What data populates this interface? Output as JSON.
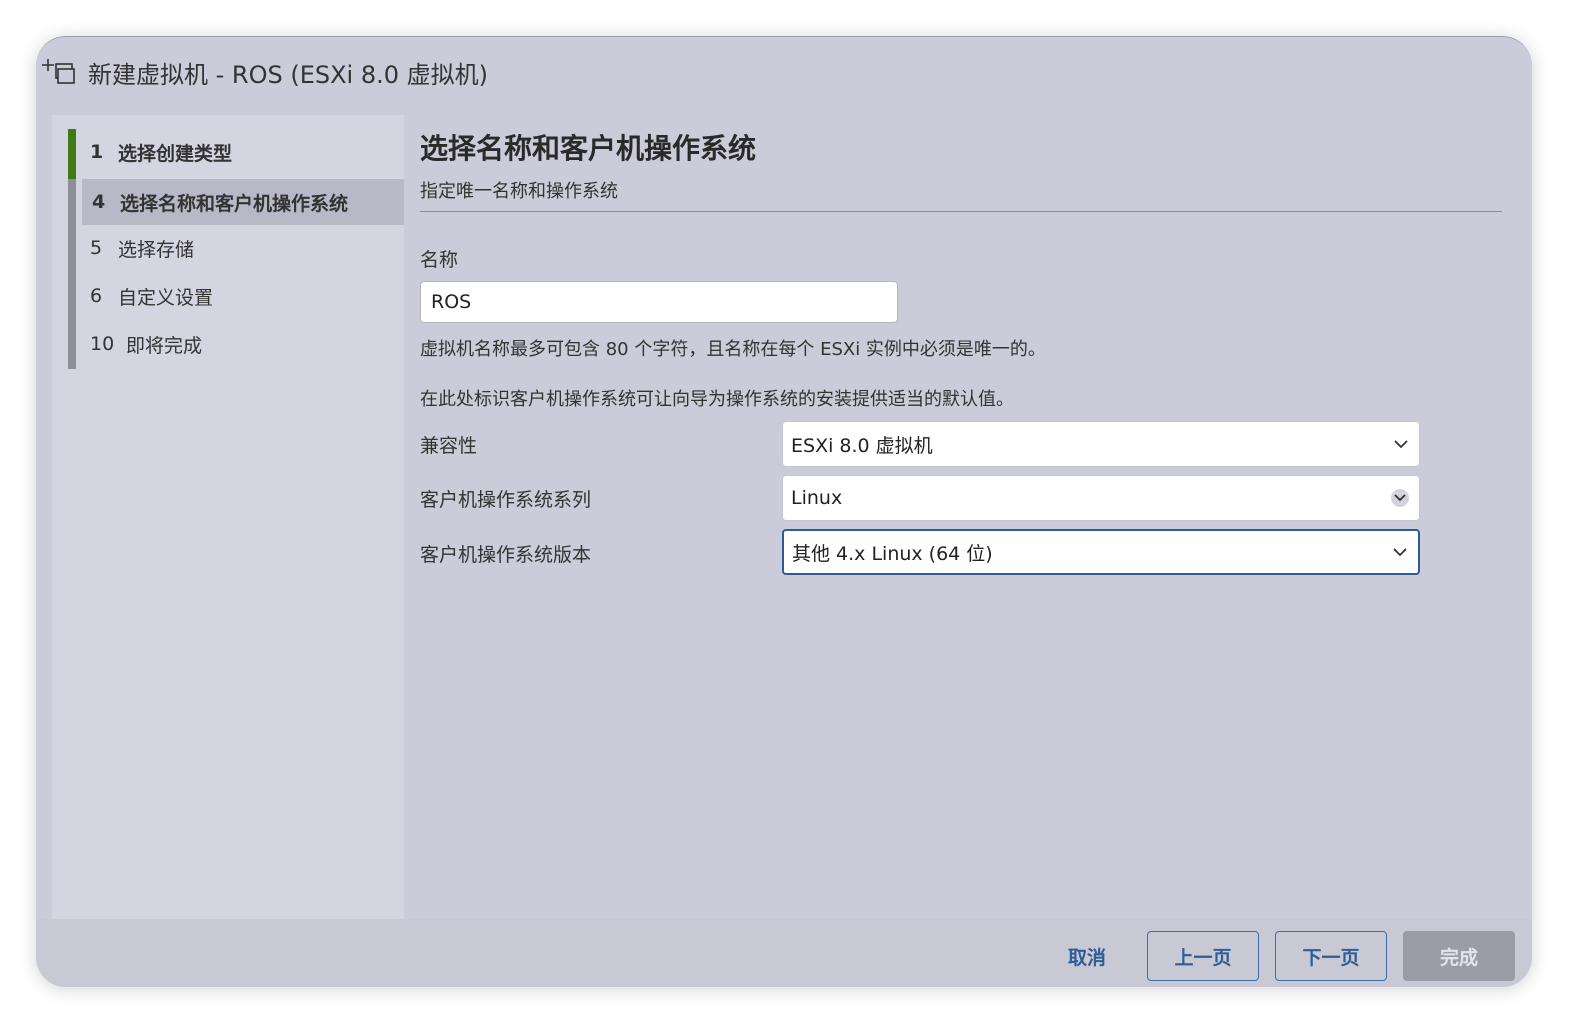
{
  "window": {
    "title": "新建虚拟机 - ROS (ESXi 8.0 虚拟机)"
  },
  "sidebar": {
    "steps": [
      {
        "num": "1",
        "label": "选择创建类型"
      },
      {
        "num": "4",
        "label": "选择名称和客户机操作系统"
      },
      {
        "num": "5",
        "label": "选择存储"
      },
      {
        "num": "6",
        "label": "自定义设置"
      },
      {
        "num": "10",
        "label": "即将完成"
      }
    ]
  },
  "main": {
    "title": "选择名称和客户机操作系统",
    "subtitle": "指定唯一名称和操作系统",
    "name_label": "名称",
    "name_value": "ROS",
    "name_hint": "虚拟机名称最多可包含 80 个字符，且名称在每个 ESXi 实例中必须是唯一的。",
    "os_hint": "在此处标识客户机操作系统可让向导为操作系统的安装提供适当的默认值。",
    "fields": [
      {
        "label": "兼容性",
        "value": "ESXi 8.0 虚拟机"
      },
      {
        "label": "客户机操作系统系列",
        "value": "Linux"
      },
      {
        "label": "客户机操作系统版本",
        "value": "其他 4.x Linux (64 位)"
      }
    ]
  },
  "footer": {
    "cancel": "取消",
    "back": "上一页",
    "next": "下一页",
    "finish": "完成"
  },
  "colors": {
    "accent": "#2e5d93",
    "done_step": "#3f7a12",
    "background": "#cbcbd9"
  },
  "icons": {
    "title": "new-vm-icon",
    "dropdown": "chevron-down-icon"
  }
}
